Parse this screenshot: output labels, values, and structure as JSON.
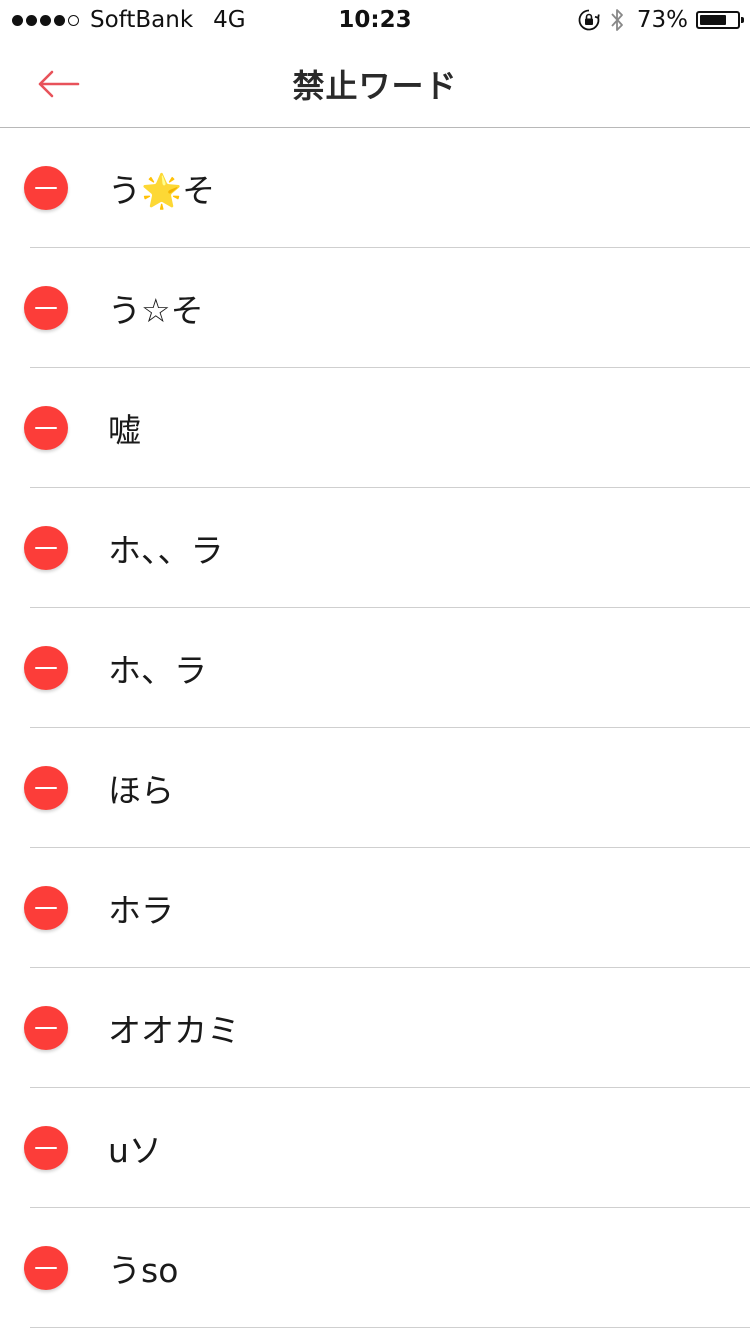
{
  "status_bar": {
    "carrier": "SoftBank",
    "network": "4G",
    "time": "10:23",
    "battery_percent": "73%",
    "battery_level": 0.73,
    "signal_bars_filled": 4,
    "signal_bars_total": 5,
    "icons": [
      "orientation-lock-icon",
      "bluetooth-icon",
      "battery-icon"
    ]
  },
  "nav": {
    "title": "禁止ワード",
    "back_icon": "left-arrow-icon",
    "accent_color": "#e8525a"
  },
  "list": {
    "delete_color": "#fc3d39",
    "items": [
      {
        "label": "う🌟そ"
      },
      {
        "label": "う☆そ"
      },
      {
        "label": "嘘"
      },
      {
        "label": "ホ、、ラ"
      },
      {
        "label": "ホ、ラ"
      },
      {
        "label": "ほら"
      },
      {
        "label": "ホラ"
      },
      {
        "label": "オオカミ"
      },
      {
        "label": "uソ"
      },
      {
        "label": "うso"
      }
    ]
  }
}
